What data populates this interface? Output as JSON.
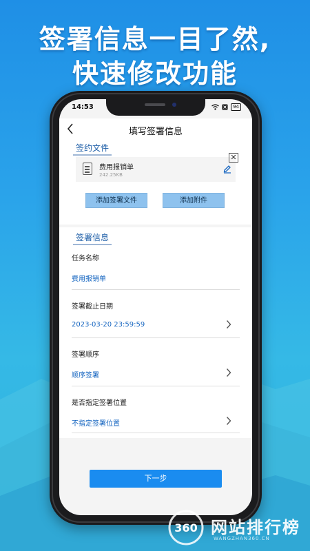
{
  "promo": {
    "line1": "签署信息一目了然,",
    "line2": "快速修改功能"
  },
  "status_bar": {
    "time": "14:53",
    "battery": "94"
  },
  "navbar": {
    "back_icon": "chevron-left-icon",
    "title": "填写签署信息"
  },
  "contract_files": {
    "section_label": "签约文件",
    "file": {
      "name": "费用报销单",
      "size": "242.25KB"
    },
    "add_sign_file_label": "添加签署文件",
    "add_attachment_label": "添加附件"
  },
  "sign_info": {
    "section_label": "签署信息",
    "fields": [
      {
        "label": "任务名称",
        "value": "费用报销单"
      },
      {
        "label": "签署截止日期",
        "value": "2023-03-20 23:59:59"
      },
      {
        "label": "签署顺序",
        "value": "顺序签署"
      },
      {
        "label": "是否指定签署位置",
        "value": "不指定签署位置"
      }
    ]
  },
  "next_button": "下一步",
  "watermark": {
    "name": "网站排行榜",
    "domain": "WANGZHAN360.CN",
    "badge": "360"
  },
  "colors": {
    "accent": "#1a8cf0",
    "value_text": "#1565c0",
    "section_label": "#1f5fa8"
  }
}
